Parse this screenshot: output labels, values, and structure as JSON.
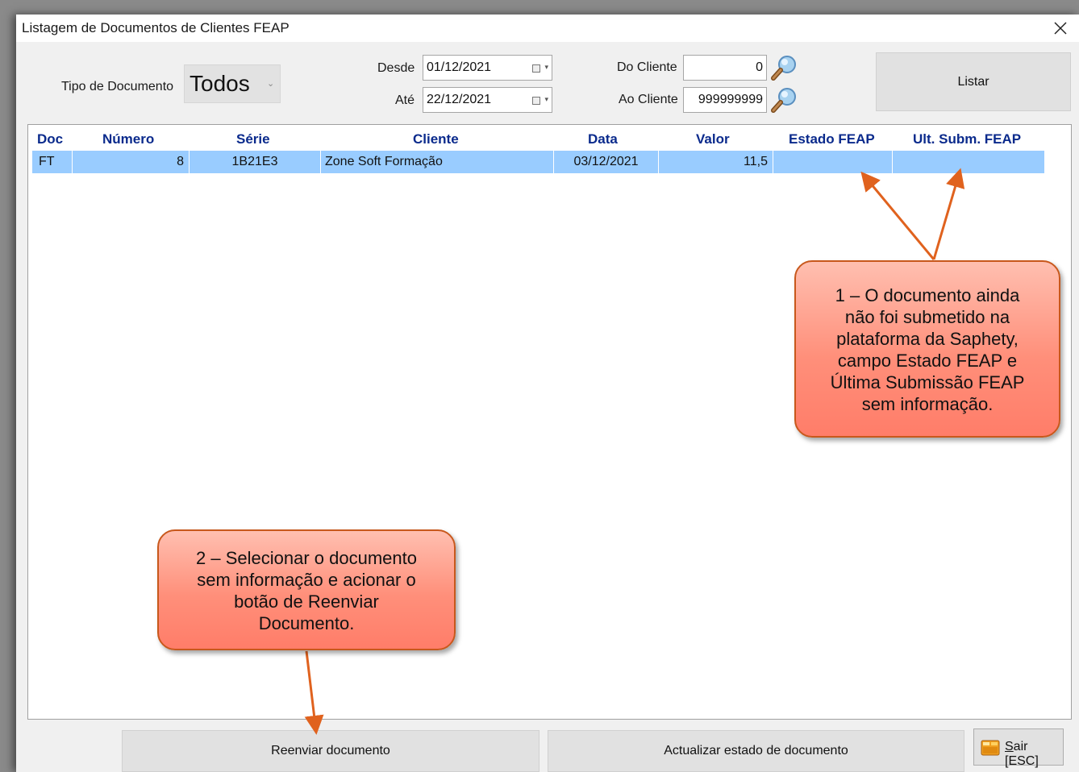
{
  "window": {
    "title": "Listagem de Documentos de Clientes FEAP"
  },
  "filters": {
    "doc_type_label": "Tipo de Documento",
    "doc_type_value": "Todos",
    "desde_label": "Desde",
    "desde_value": "01/12/2021",
    "ate_label": "Até",
    "ate_value": "22/12/2021",
    "do_cliente_label": "Do Cliente",
    "do_cliente_value": "0",
    "ao_cliente_label": "Ao Cliente",
    "ao_cliente_value": "999999999"
  },
  "listar_label": "Listar",
  "table": {
    "columns": [
      "Doc",
      "Número",
      "Série",
      "Cliente",
      "Data",
      "Valor",
      "Estado FEAP",
      "Ult. Subm. FEAP"
    ],
    "rows": [
      {
        "doc": "FT",
        "numero": "8",
        "serie": "1B21E3",
        "cliente": "Zone Soft Formação",
        "data": "03/12/2021",
        "valor": "11,5",
        "estado": "",
        "ult_subm": ""
      }
    ]
  },
  "callouts": {
    "one": [
      "1 – O documento ainda",
      "não foi submetido na",
      "plataforma da Saphety,",
      "campo Estado FEAP e",
      "Última Submissão FEAP",
      "sem informação."
    ],
    "two": [
      "2 – Selecionar o documento",
      "sem informação e acionar o",
      "botão de Reenviar",
      "Documento."
    ]
  },
  "buttons": {
    "reenviar": "Reenviar documento",
    "actualizar": "Actualizar estado de documento",
    "sair_accel": "S",
    "sair_rest": "air [ESC]"
  },
  "colors": {
    "header_text": "#0a2a8c",
    "selected_row": "#99ccff",
    "callout_border": "#c8581c",
    "arrow": "#e0621e"
  }
}
